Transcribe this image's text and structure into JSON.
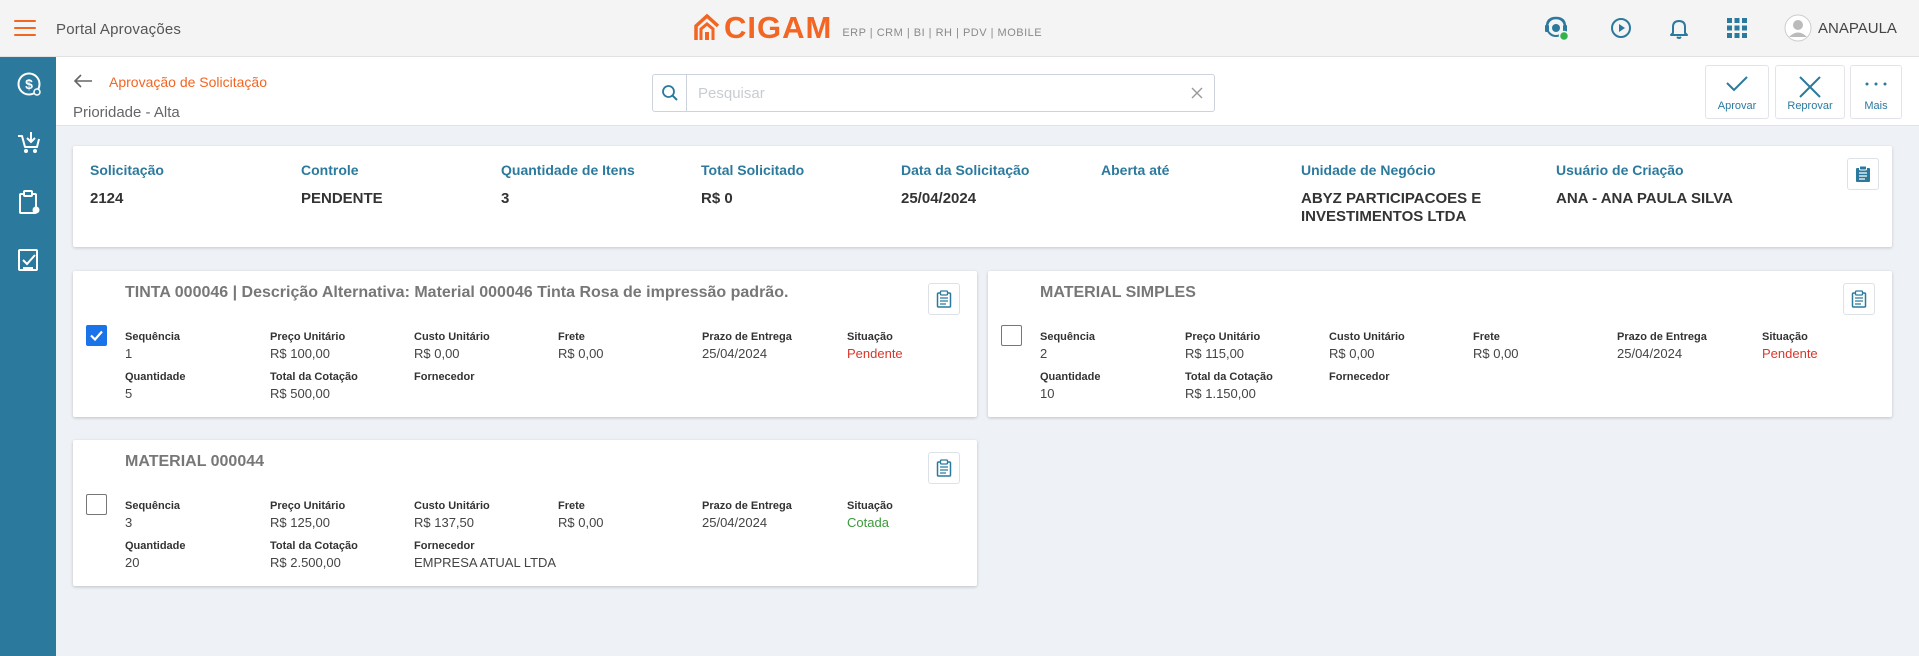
{
  "topbar": {
    "portal_title": "Portal Aprovações",
    "logo_text": "CIGAM",
    "logo_sub": "ERP | CRM | BI | RH | PDV | MOBILE",
    "user_name": "ANAPAULA",
    "icons": [
      "support-agent-icon",
      "play-circle-icon",
      "bell-icon",
      "apps-grid-icon",
      "user-avatar-icon"
    ],
    "brand_color": "#f26522",
    "status_online_color": "#2fb34a"
  },
  "sidebar": {
    "color": "#2b7a9e",
    "items": [
      "dollar-circle-icon",
      "cart-download-icon",
      "clipboard-icon",
      "check-document-icon"
    ]
  },
  "subheader": {
    "breadcrumb": "Aprovação de Solicitação",
    "priority": "Prioridade - Alta",
    "search_placeholder": "Pesquisar",
    "actions": [
      {
        "label": "Aprovar",
        "icon": "check-icon"
      },
      {
        "label": "Reprovar",
        "icon": "close-icon"
      },
      {
        "label": "Mais",
        "icon": "more-icon"
      }
    ]
  },
  "summary": {
    "fields": [
      {
        "label": "Solicitação",
        "value": "2124"
      },
      {
        "label": "Controle",
        "value": "PENDENTE"
      },
      {
        "label": "Quantidade de Itens",
        "value": "3"
      },
      {
        "label": "Total Solicitado",
        "value": "R$ 0"
      },
      {
        "label": "Data da Solicitação",
        "value": "25/04/2024"
      },
      {
        "label": "Aberta até",
        "value": ""
      },
      {
        "label": "Unidade de Negócio",
        "value": "ABYZ PARTICIPACOES E INVESTIMENTOS LTDA"
      },
      {
        "label": "Usuário de Criação",
        "value": "ANA - ANA PAULA SILVA"
      }
    ]
  },
  "labels": {
    "sequencia": "Sequência",
    "preco_unitario": "Preço Unitário",
    "custo_unitario": "Custo Unitário",
    "frete": "Frete",
    "prazo_entrega": "Prazo de Entrega",
    "situacao": "Situação",
    "quantidade": "Quantidade",
    "total_cotacao": "Total da Cotação",
    "fornecedor": "Fornecedor"
  },
  "items": [
    {
      "title": "TINTA 000046 | Descrição Alternativa: Material 000046 Tinta Rosa de impressão padrão.",
      "checked": true,
      "sequencia": "1",
      "preco_unitario": "R$ 100,00",
      "custo_unitario": "R$ 0,00",
      "frete": "R$ 0,00",
      "prazo_entrega": "25/04/2024",
      "situacao": "Pendente",
      "quantidade": "5",
      "total_cotacao": "R$ 500,00",
      "fornecedor": ""
    },
    {
      "title": "MATERIAL SIMPLES",
      "checked": false,
      "sequencia": "2",
      "preco_unitario": "R$ 115,00",
      "custo_unitario": "R$ 0,00",
      "frete": "R$ 0,00",
      "prazo_entrega": "25/04/2024",
      "situacao": "Pendente",
      "quantidade": "10",
      "total_cotacao": "R$ 1.150,00",
      "fornecedor": ""
    },
    {
      "title": "MATERIAL 000044",
      "checked": false,
      "sequencia": "3",
      "preco_unitario": "R$ 125,00",
      "custo_unitario": "R$ 137,50",
      "frete": "R$ 0,00",
      "prazo_entrega": "25/04/2024",
      "situacao": "Cotada",
      "quantidade": "20",
      "total_cotacao": "R$ 2.500,00",
      "fornecedor": "EMPRESA ATUAL LTDA"
    }
  ],
  "colors": {
    "pendente": "#d9362a",
    "cotada": "#3b9a3b",
    "accent": "#2b7a9e",
    "checkbox_checked": "#1a73e8"
  }
}
